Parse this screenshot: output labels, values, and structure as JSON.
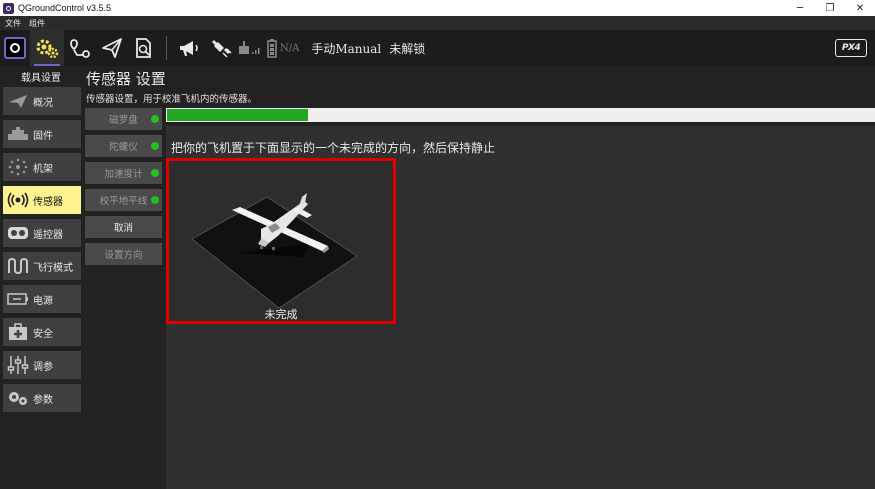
{
  "window": {
    "title": "QGroundControl v3.5.5",
    "controls": [
      "─",
      "❐",
      "✕"
    ]
  },
  "menu": [
    "文件",
    "组件"
  ],
  "toolbar": {
    "gps_count": "N/A",
    "flight_mode": "手动Manual",
    "arm_status": "未解锁",
    "brand": "PX4"
  },
  "sidebar": {
    "heading": "载具设置",
    "items": [
      {
        "label": "概况",
        "icon": "paper-plane-icon"
      },
      {
        "label": "固件",
        "icon": "firmware-icon"
      },
      {
        "label": "机架",
        "icon": "airframe-icon"
      },
      {
        "label": "传感器",
        "icon": "sensors-icon",
        "active": true
      },
      {
        "label": "遥控器",
        "icon": "radio-icon"
      },
      {
        "label": "飞行模式",
        "icon": "flight-modes-icon"
      },
      {
        "label": "电源",
        "icon": "battery-icon"
      },
      {
        "label": "安全",
        "icon": "safety-icon"
      },
      {
        "label": "调参",
        "icon": "tuning-icon"
      },
      {
        "label": "参数",
        "icon": "parameters-icon"
      }
    ]
  },
  "main": {
    "title": "传感器 设置",
    "subtitle": "传感器设置，用于校准飞机内的传感器。",
    "instruction": "把你的飞机置于下面显示的一个未完成的方向，然后保持静止",
    "progress": 0.2,
    "orientation_status": "未完成"
  },
  "sensor_buttons": [
    {
      "label": "磁罗盘",
      "status_dot": true,
      "enabled": false
    },
    {
      "label": "陀螺仪",
      "status_dot": true,
      "enabled": false
    },
    {
      "label": "加速度计",
      "status_dot": true,
      "enabled": false
    },
    {
      "label": "校平地平线",
      "status_dot": true,
      "enabled": false
    },
    {
      "label": "取消",
      "status_dot": false,
      "enabled": true
    },
    {
      "label": "设置方向",
      "status_dot": false,
      "enabled": false
    }
  ],
  "colors": {
    "accent": "#7b61c4",
    "active_nav": "#fff291",
    "progress": "#23a824",
    "status_ok": "#22c022",
    "highlight_border": "#e00000"
  }
}
